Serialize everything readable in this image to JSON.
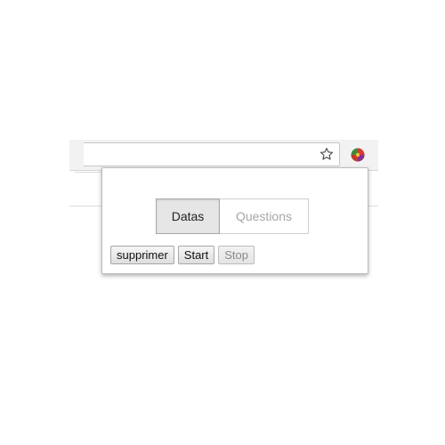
{
  "browser": {
    "star_icon": "star-outline-icon",
    "extension_icon": "extension-globe-icon"
  },
  "popup": {
    "tabs": [
      {
        "label": "Datas",
        "active": true
      },
      {
        "label": "Questions",
        "active": false
      }
    ],
    "buttons": {
      "supprimer": "supprimer",
      "start": "Start",
      "stop": "Stop"
    }
  },
  "colors": {
    "active_tab_bg": "#e6e6e6",
    "inactive_tab_text": "#a6a6a6",
    "border": "#bdbdbd"
  }
}
